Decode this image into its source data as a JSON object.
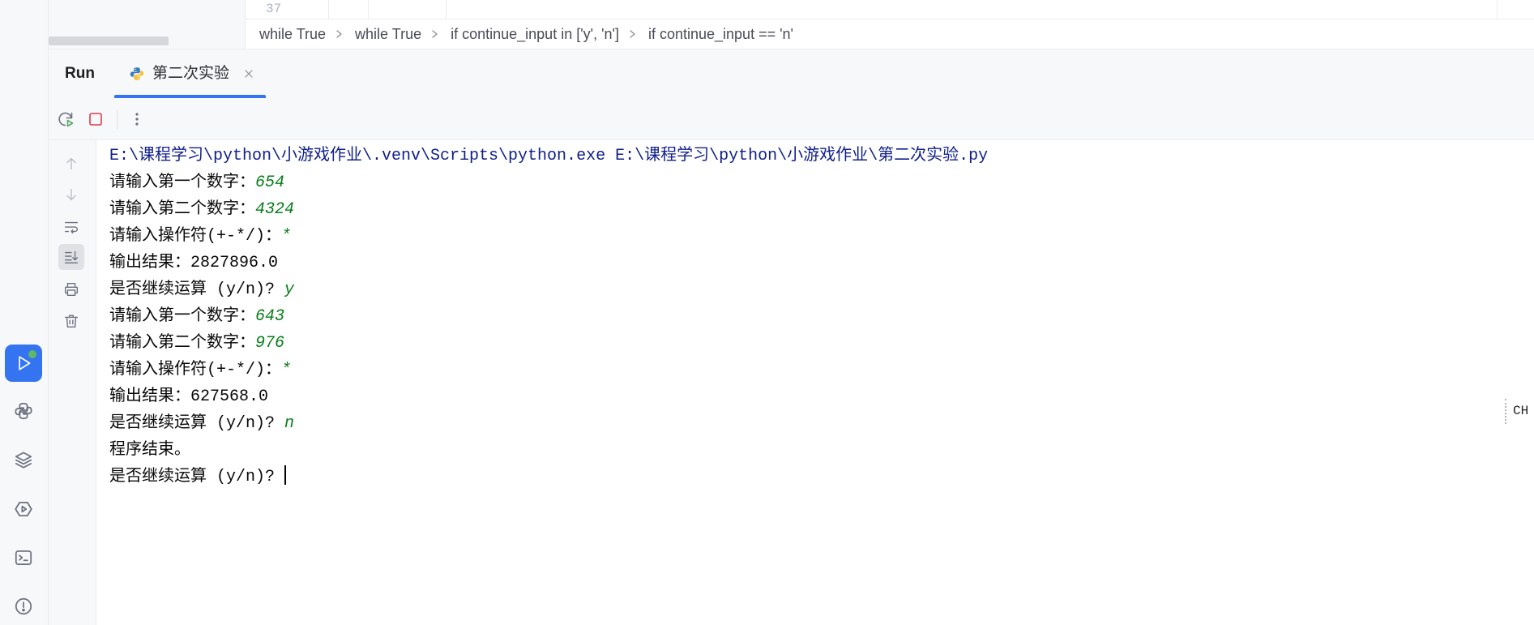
{
  "editor": {
    "line_number": "37",
    "breadcrumbs": [
      "while True",
      "while True",
      "if continue_input in ['y', 'n']",
      "if continue_input == 'n'"
    ],
    "breadcrumb_separator_icon": "chevron-right-icon"
  },
  "activity_bar": {
    "items": [
      {
        "icon": "run-icon",
        "selected": true,
        "indicator": "green-dot"
      },
      {
        "icon": "python-icon"
      },
      {
        "icon": "layers-icon"
      },
      {
        "icon": "services-icon"
      },
      {
        "icon": "terminal-icon"
      },
      {
        "icon": "problems-icon"
      }
    ]
  },
  "run_panel": {
    "title": "Run",
    "tabs": [
      {
        "label": "第二次实验",
        "icon": "python-file-icon",
        "active": true,
        "close_icon": "close-icon"
      }
    ],
    "toolbar": [
      {
        "icon": "rerun-icon"
      },
      {
        "icon": "stop-icon"
      },
      {
        "icon": "more-vertical-icon"
      }
    ],
    "side_toolbar": [
      {
        "icon": "arrow-up-icon",
        "enabled": false
      },
      {
        "icon": "arrow-down-icon",
        "enabled": false
      },
      {
        "icon": "soft-wrap-icon"
      },
      {
        "icon": "scroll-to-end-icon",
        "selected": true
      },
      {
        "icon": "print-icon"
      },
      {
        "icon": "trash-icon"
      }
    ]
  },
  "console": {
    "lines": [
      {
        "text": "E:\\课程学习\\python\\小游戏作业\\.venv\\Scripts\\python.exe E:\\课程学习\\python\\小游戏作业\\第二次实验.py"
      },
      {
        "text": "请输入第一个数字：",
        "input": "654"
      },
      {
        "text": "请输入第二个数字：",
        "input": "4324"
      },
      {
        "text": "请输入操作符(+-*/)：",
        "input": "*"
      },
      {
        "text": "输出结果：2827896.0"
      },
      {
        "text": "是否继续运算 (y/n)? ",
        "input": "y"
      },
      {
        "text": "请输入第一个数字：",
        "input": "643"
      },
      {
        "text": "请输入第二个数字：",
        "input": "976"
      },
      {
        "text": "请输入操作符(+-*/)：",
        "input": "*"
      },
      {
        "text": "输出结果：627568.0"
      },
      {
        "text": "是否继续运算 (y/n)? ",
        "input": "n"
      },
      {
        "text": "程序结束。"
      },
      {
        "text": "是否继续运算 (y/n)? "
      }
    ]
  },
  "input_method_indicator": "CH",
  "colors": {
    "accent": "#3574f0",
    "system_output": "#10208a",
    "stdout": "#080808",
    "user_input": "#067d17",
    "stop": "#db3b4b",
    "running_indicator": "#5fb865"
  }
}
